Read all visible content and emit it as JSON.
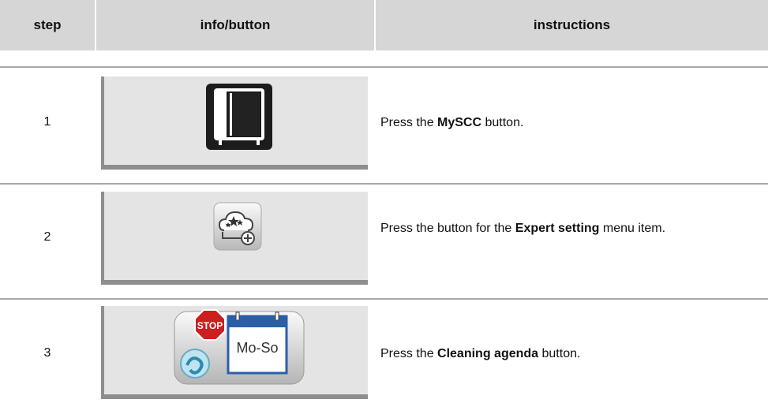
{
  "header": {
    "step": "step",
    "info": "info/button",
    "instructions": "instructions"
  },
  "rows": [
    {
      "step": "1",
      "icon": "oven-icon",
      "instr_pre": "Press the ",
      "instr_bold": "MySCC",
      "instr_post": " button."
    },
    {
      "step": "2",
      "icon": "expert-setting-icon",
      "instr_pre": "Press the button for the ",
      "instr_bold": "Expert setting",
      "instr_post": " menu item."
    },
    {
      "step": "3",
      "icon": "cleaning-agenda-icon",
      "icon_text_stop": "STOP",
      "icon_text_days": "Mo-So",
      "instr_pre": "Press the ",
      "instr_bold": "Cleaning agenda",
      "instr_post": " button."
    }
  ],
  "colors": {
    "header_bg": "#d6d6d6",
    "cell_bg": "#e4e4e4",
    "cell_border": "#8e8e8e",
    "stop_red": "#cc1f1f",
    "calendar_blue": "#2a5fa8"
  }
}
